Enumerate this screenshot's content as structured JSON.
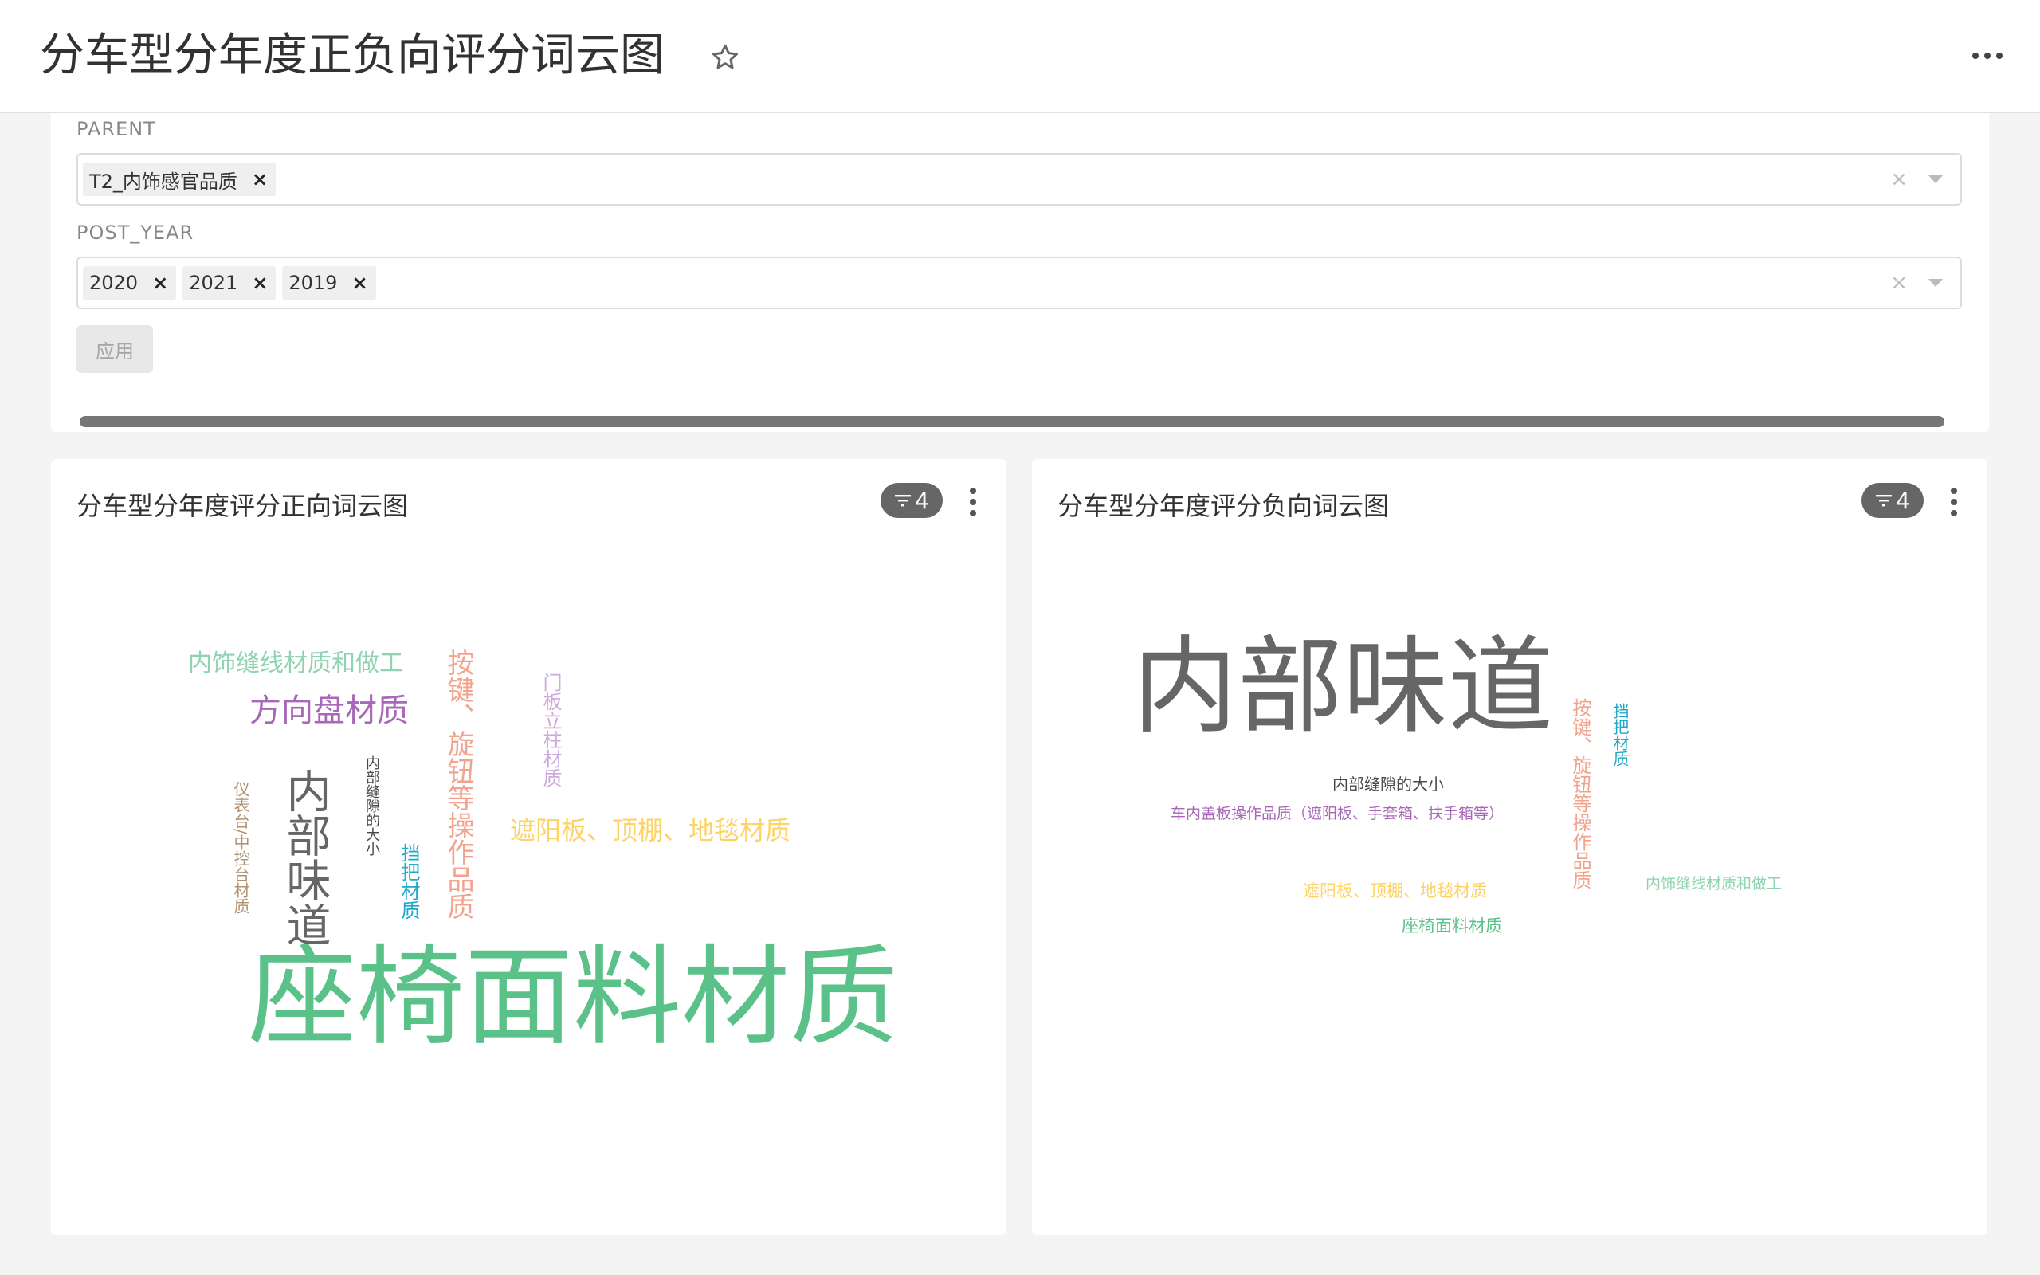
{
  "header": {
    "title": "分车型分年度正负向评分词云图"
  },
  "filters": {
    "parent": {
      "label": "PARENT",
      "selected": [
        "T2_内饰感官品质"
      ]
    },
    "post_year": {
      "label": "POST_YEAR",
      "selected": [
        "2020",
        "2021",
        "2019"
      ]
    },
    "apply_label": "应用"
  },
  "charts": {
    "positive": {
      "title": "分车型分年度评分正向词云图",
      "filter_count": "4",
      "words": [
        "座椅面料材质",
        "内部味道",
        "方向盘材质",
        "内饰缝线材质和做工",
        "按键、旋钮等操作品质",
        "遮阳板、顶棚、地毯材质",
        "门板立柱材质",
        "内部缝隙的大小",
        "挡把材质",
        "仪表台/中控台材质"
      ]
    },
    "negative": {
      "title": "分车型分年度评分负向词云图",
      "filter_count": "4",
      "words": [
        "内部味道",
        "按键、旋钮等操作品质",
        "挡把材质",
        "内部缝隙的大小",
        "车内盖板操作品质（遮阳板、手套箱、扶手箱等）",
        "遮阳板、顶棚、地毯材质",
        "内饰缝线材质和做工",
        "座椅面料材质"
      ]
    }
  },
  "colors": {
    "green": "#5ac189",
    "gray": "#666666",
    "purple": "#a868b7",
    "mint": "#8fd3b0",
    "salmon": "#f2a38d",
    "yellow": "#fcd364",
    "lavender": "#ccaadd",
    "teal": "#1fa8c9",
    "tan": "#b0926e",
    "dark": "#484848"
  },
  "icons": {
    "star": "star-outline-icon",
    "more": "more-horizontal-icon",
    "filter": "filter-icon",
    "kebab": "more-vertical-icon"
  }
}
